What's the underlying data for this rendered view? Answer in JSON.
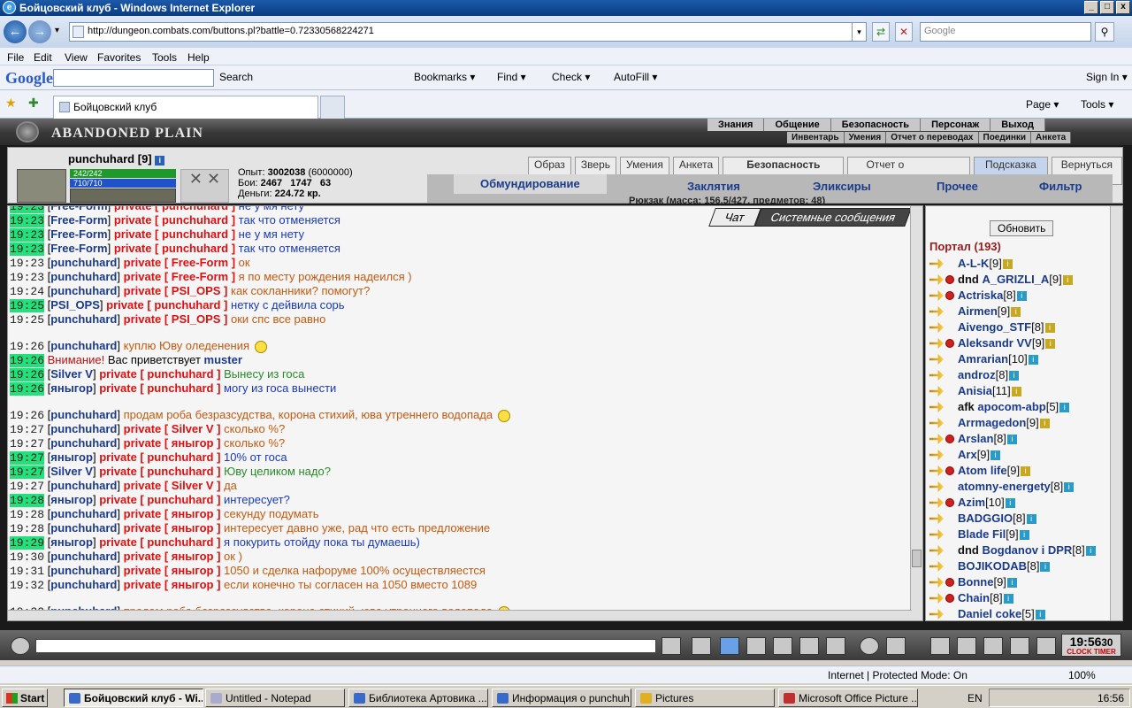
{
  "window": {
    "title": "Бойцовский клуб - Windows Internet Explorer",
    "logo_glyph": "e",
    "min": "_",
    "max": "□",
    "close": "x"
  },
  "browser": {
    "back_glyph": "←",
    "forward_glyph": "→",
    "dropdown_glyph": "▾",
    "url": "http://dungeon.combats.com/buttons.pl?battle=0.72330568224271",
    "refresh_glyph": "⇄",
    "stop_glyph": "✕",
    "search_glyph": "⚲",
    "search_placeholder": "Google",
    "menu": [
      "File",
      "Edit",
      "View",
      "Favorites",
      "Tools",
      "Help"
    ],
    "google_logo": "Google",
    "google_toolbar": {
      "search": "Search",
      "bookmarks": "Bookmarks ▾",
      "find": "Find ▾",
      "check": "Check ▾",
      "autofill": "AutoFill ▾",
      "signin": "Sign In ▾"
    },
    "tab_title": "Бойцовский клуб",
    "favorites_glyph": "★",
    "add_glyph": "✚",
    "toolbar_right": {
      "page": "Page ▾",
      "tools": "Tools ▾"
    }
  },
  "game": {
    "banner_title": "ABANDONED PLAIN",
    "top_nav": [
      "Знания",
      "Общение",
      "Безопасность",
      "Персонаж",
      "Выход"
    ],
    "sub_nav": [
      "Инвентарь",
      "Умения",
      "Отчет о переводах",
      "Поединки",
      "Анкета"
    ],
    "player": {
      "name": "punchuhard",
      "level": "[9]",
      "info_glyph": "i",
      "hp": "242/242",
      "mp": "710/710",
      "tools_glyph": "✕ ✕"
    },
    "stats": {
      "exp_label": "Опыт:",
      "exp": "3002038",
      "exp_next": "(6000000)",
      "fights_label": "Бои:",
      "wins": "2467",
      "losses": "1747",
      "draws": "63",
      "money_label": "Деньги:",
      "money": "224.72 кр."
    },
    "buttons": [
      "Образ",
      "Зверь",
      "Умения",
      "Анкета",
      "Безопасность",
      "Отчет о переводах",
      "Подсказка",
      "Вернуться"
    ],
    "inv_tabs": [
      "Обмундирование",
      "Заклятия",
      "Эликсиры",
      "Прочее",
      "Фильтр"
    ],
    "backpack": "Рюкзак (масса: 156.5/427, предметов: 48)",
    "chat_tabs": [
      "Чат",
      "Системные сообщения"
    ],
    "update_button": "Обновить",
    "portal": "Портал (193)",
    "emoji_tag": "!!!"
  },
  "chat": [
    {
      "t": "19:23",
      "hl": true,
      "u": "Free-Form",
      "p": "private [ punchuhard ]",
      "m": "не у мя нету",
      "c": "bl"
    },
    {
      "t": "19:23",
      "hl": true,
      "u": "Free-Form",
      "p": "private [ punchuhard ]",
      "m": "так что отменяется",
      "c": "bl"
    },
    {
      "t": "19:23",
      "hl": true,
      "u": "Free-Form",
      "p": "private [ punchuhard ]",
      "m": "не у мя нету",
      "c": "bl"
    },
    {
      "t": "19:23",
      "hl": true,
      "u": "Free-Form",
      "p": "private [ punchuhard ]",
      "m": "так что отменяется",
      "c": "bl"
    },
    {
      "t": "19:23",
      "hl": false,
      "u": "punchuhard",
      "p": "private [ Free-Form ]",
      "m": "ок",
      "c": "pv"
    },
    {
      "t": "19:23",
      "hl": false,
      "u": "punchuhard",
      "p": "private [ Free-Form ]",
      "m": "я по месту рождения надеился )",
      "c": "pv"
    },
    {
      "t": "19:24",
      "hl": false,
      "u": "punchuhard",
      "p": "private [ PSI_OPS ]",
      "m": "как сокланники? помогут?",
      "c": "pv"
    },
    {
      "t": "19:25",
      "hl": true,
      "u": "PSI_OPS",
      "p": "private [ punchuhard ]",
      "m": "нетку с дейвила сорь",
      "c": "bl"
    },
    {
      "t": "19:25",
      "hl": false,
      "u": "punchuhard",
      "p": "private [ PSI_OPS ]",
      "m": "оки спс все равно",
      "c": "pv"
    },
    {
      "t": "19:26",
      "hl": false,
      "u": "punchuhard",
      "p": "",
      "m": "куплю Юву оледенения",
      "c": "pv",
      "gap": true,
      "emo": true
    },
    {
      "t": "19:26",
      "hl": true,
      "sys": true,
      "warn": "Внимание!",
      "m": "Вас приветствует",
      "who": "muster"
    },
    {
      "t": "19:26",
      "hl": true,
      "u": "Silver V",
      "p": "private [ punchuhard ]",
      "m": "Вынесу из госа",
      "c": "sm"
    },
    {
      "t": "19:26",
      "hl": true,
      "u": "яныгор",
      "p": "private [ punchuhard ]",
      "m": "могу из госа вынести",
      "c": "bl"
    },
    {
      "t": "19:26",
      "hl": false,
      "u": "punchuhard",
      "p": "",
      "m": "продам роба безразсудства, корона стихий, юва утреннего водопада",
      "c": "pv",
      "gap": true,
      "emo": true
    },
    {
      "t": "19:27",
      "hl": false,
      "u": "punchuhard",
      "p": "private [ Silver V ]",
      "m": "сколько %?",
      "c": "pv"
    },
    {
      "t": "19:27",
      "hl": false,
      "u": "punchuhard",
      "p": "private [ яныгор ]",
      "m": "сколько %?",
      "c": "pv"
    },
    {
      "t": "19:27",
      "hl": true,
      "u": "яныгор",
      "p": "private [ punchuhard ]",
      "m": "10% от госа",
      "c": "bl"
    },
    {
      "t": "19:27",
      "hl": true,
      "u": "Silver V",
      "p": "private [ punchuhard ]",
      "m": "Юву целиком надо?",
      "c": "sm"
    },
    {
      "t": "19:27",
      "hl": false,
      "u": "punchuhard",
      "p": "private [ Silver V ]",
      "m": "да",
      "c": "pv"
    },
    {
      "t": "19:28",
      "hl": true,
      "u": "яныгор",
      "p": "private [ punchuhard ]",
      "m": "интересует?",
      "c": "bl"
    },
    {
      "t": "19:28",
      "hl": false,
      "u": "punchuhard",
      "p": "private [ яныгор ]",
      "m": "секунду подумать",
      "c": "pv"
    },
    {
      "t": "19:28",
      "hl": false,
      "u": "punchuhard",
      "p": "private [ яныгор ]",
      "m": "интересует давно уже, рад что есть предложение",
      "c": "pv"
    },
    {
      "t": "19:29",
      "hl": true,
      "u": "яныгор",
      "p": "private [ punchuhard ]",
      "m": "я покурить отойду пока ты думаешь)",
      "c": "bl"
    },
    {
      "t": "19:30",
      "hl": false,
      "u": "punchuhard",
      "p": "private [ яныгор ]",
      "m": "ок )",
      "c": "pv"
    },
    {
      "t": "19:31",
      "hl": false,
      "u": "punchuhard",
      "p": "private [ яныгор ]",
      "m": "1050 и сделка нафоруме 100% осуществляестся",
      "c": "pv"
    },
    {
      "t": "19:32",
      "hl": false,
      "u": "punchuhard",
      "p": "private [ яныгор ]",
      "m": "если конечно ты согласен на 1050 вместо 1089",
      "c": "pv"
    },
    {
      "t": "19:32",
      "hl": false,
      "u": "punchuhard",
      "p": "",
      "m": "продам роба безразсудства, корона стихий, юва утреннего водопада",
      "c": "pv",
      "gap": true,
      "emo": true
    }
  ],
  "players": [
    {
      "n": "A-L-K",
      "lv": "[9]",
      "y": true
    },
    {
      "n": "A_GRIZLI_A",
      "lv": "[9]",
      "r": true,
      "pre": "dnd",
      "y": true
    },
    {
      "n": "Actriska",
      "lv": "[8]",
      "r": true
    },
    {
      "n": "Airmen",
      "lv": "[9]",
      "y": true
    },
    {
      "n": "Aivengo_STF",
      "lv": "[8]",
      "y": true
    },
    {
      "n": "Aleksandr VV",
      "lv": "[9]",
      "r": true,
      "y": true
    },
    {
      "n": "Amrarian",
      "lv": "[10]"
    },
    {
      "n": "androz",
      "lv": "[8]"
    },
    {
      "n": "Anisia",
      "lv": "[11]",
      "y": true
    },
    {
      "n": "apocom-abp",
      "lv": "[5]",
      "pre": "afk"
    },
    {
      "n": "Arrmagedon",
      "lv": "[9]",
      "y": true
    },
    {
      "n": "Arslan",
      "lv": "[8]",
      "r": true
    },
    {
      "n": "Arx",
      "lv": "[9]"
    },
    {
      "n": "Atom life",
      "lv": "[9]",
      "r": true,
      "y": true
    },
    {
      "n": "atomny-energety",
      "lv": "[8]"
    },
    {
      "n": "Azim",
      "lv": "[10]",
      "r": true
    },
    {
      "n": "BADGGIO",
      "lv": "[8]"
    },
    {
      "n": "Blade Fil",
      "lv": "[9]"
    },
    {
      "n": "Bogdanov i DPR",
      "lv": "[8]",
      "pre": "dnd"
    },
    {
      "n": "BOJIKODAB",
      "lv": "[8]"
    },
    {
      "n": "Bonne",
      "lv": "[9]",
      "r": true
    },
    {
      "n": "Chain",
      "lv": "[8]",
      "r": true
    },
    {
      "n": "Daniel coke",
      "lv": "[5]"
    }
  ],
  "bottom": {
    "clock": "19:56",
    "clock_sub": "30",
    "clock_label": "CLOCK TIMER"
  },
  "status": {
    "zone": "Internet | Protected Mode: On",
    "zoom": "100%"
  },
  "taskbar": {
    "start": "Start",
    "items": [
      "Бойцовский клуб - Wi...",
      "Untitled - Notepad",
      "Библиотека Артовика ...",
      "Информация о punchuh...",
      "Pictures",
      "Microsoft Office Picture ..."
    ],
    "lang": "EN",
    "time": "16:56"
  }
}
